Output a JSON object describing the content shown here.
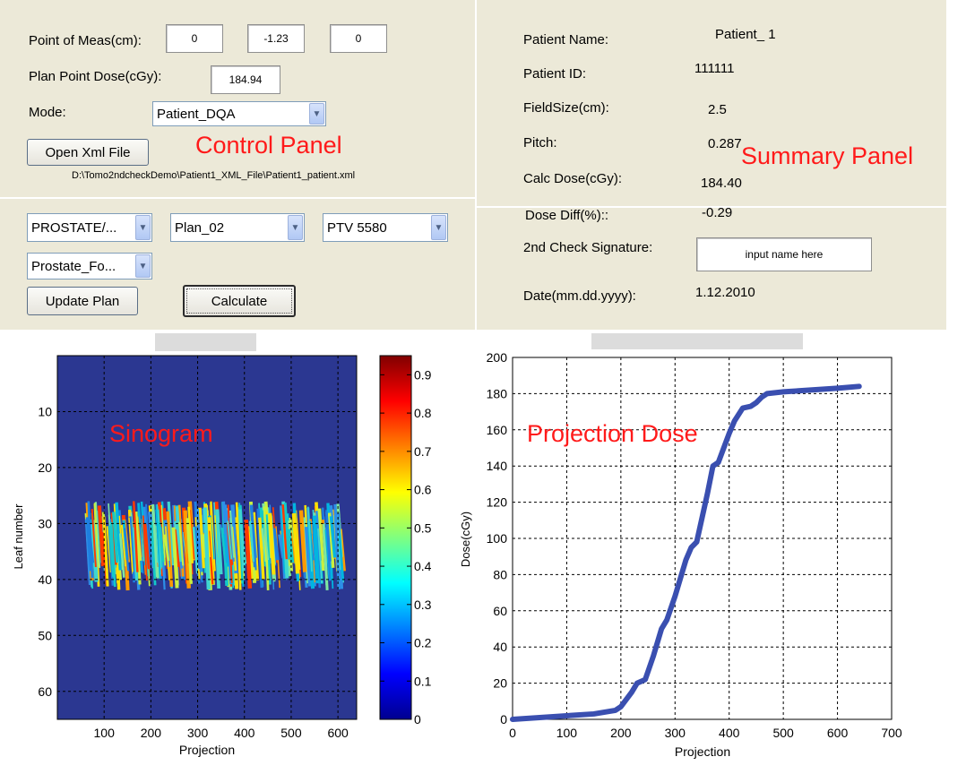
{
  "control": {
    "point_label": "Point of Meas(cm):",
    "point_x": "0",
    "point_y": "-1.23",
    "point_z": "0",
    "dose_label": "Plan Point Dose(cGy):",
    "dose_value": "184.94",
    "mode_label": "Mode:",
    "mode_value": "Patient_DQA",
    "open_button": "Open Xml File",
    "panel_title": "Control Panel",
    "file_path": "D:\\Tomo2ndcheckDemo\\Patient1_XML_File\\Patient1_patient.xml",
    "dropdown_protocol": "PROSTATE/...",
    "dropdown_plan": "Plan_02",
    "dropdown_ptv": "PTV 5580",
    "dropdown_structure": "Prostate_Fo...",
    "update_button": "Update Plan",
    "calculate_button": "Calculate"
  },
  "summary": {
    "panel_title": "Summary Panel",
    "patient_name_label": "Patient Name:",
    "patient_name": "Patient_ 1",
    "patient_id_label": "Patient ID:",
    "patient_id": "111111",
    "field_size_label": "FieldSize(cm):",
    "field_size": "2.5",
    "pitch_label": "Pitch:",
    "pitch": "0.287",
    "calc_dose_label": "Calc Dose(cGy):",
    "calc_dose": "184.40",
    "dose_diff_label": "Dose Diff(%)::",
    "dose_diff": "-0.29",
    "signature_label": "2nd Check Signature:",
    "signature_placeholder": "input name here",
    "date_label": "Date(mm.dd.yyyy):",
    "date": "1.12.2010"
  },
  "sinogram": {
    "annotation": "Sinogram",
    "ylabel": "Leaf number",
    "xlabel": "Projection",
    "xticks": [
      "100",
      "200",
      "300",
      "400",
      "500",
      "600"
    ],
    "yticks": [
      "10",
      "20",
      "30",
      "40",
      "50",
      "60"
    ],
    "colorbar_ticks": [
      "0",
      "0.1",
      "0.2",
      "0.3",
      "0.4",
      "0.5",
      "0.6",
      "0.7",
      "0.8",
      "0.9"
    ],
    "background_color": "#2b3791"
  },
  "chart_data": {
    "type": "line",
    "annotation": "Projection Dose",
    "xlabel": "Projection",
    "ylabel": "Dose(cGy)",
    "xlim": [
      0,
      700
    ],
    "ylim": [
      0,
      200
    ],
    "xticks": [
      "0",
      "100",
      "200",
      "300",
      "400",
      "500",
      "600",
      "700"
    ],
    "yticks": [
      "0",
      "20",
      "40",
      "60",
      "80",
      "100",
      "120",
      "140",
      "160",
      "180",
      "200"
    ],
    "grid": true,
    "line_color": "#3a4fb0",
    "annotation_color": "#ff1a1a",
    "x": [
      0,
      50,
      100,
      150,
      190,
      200,
      220,
      230,
      245,
      260,
      275,
      285,
      300,
      320,
      330,
      340,
      360,
      370,
      380,
      400,
      410,
      425,
      440,
      450,
      460,
      470,
      500,
      550,
      600,
      640
    ],
    "y": [
      0,
      1,
      2,
      3,
      5,
      7,
      15,
      20,
      22,
      35,
      50,
      55,
      68,
      88,
      95,
      98,
      125,
      140,
      142,
      158,
      165,
      172,
      173,
      175,
      178,
      180,
      181,
      182,
      183,
      184
    ]
  }
}
